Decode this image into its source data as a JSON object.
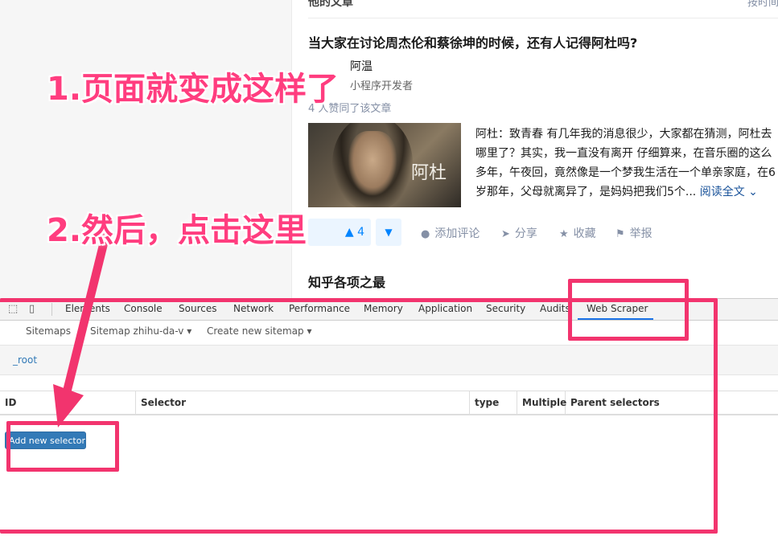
{
  "article": {
    "section_header": "他的文章",
    "section_link": "按时间",
    "title": "当大家在讨论周杰伦和蔡徐坤的时候，还有人记得阿杜吗?",
    "author_name": "阿温",
    "author_desc": "小程序开发者",
    "likers": "4 人赞同了该文章",
    "thumb_text": "阿杜",
    "excerpt": "阿杜：致青春 有几年我的消息很少，大家都在猜测，阿杜去哪里了？其实，我一直没有离开 仔细算来，在音乐圈的这么多年，午夜回，竟然像是一个梦我生活在一个单亲家庭，在6岁那年，父母就离异了，是妈妈把我们5个...",
    "read_more": "阅读全文 ⌄",
    "vote_up": "▲ 4",
    "vote_down": "▼",
    "actions": {
      "comment": "添加评论",
      "share": "分享",
      "favorite": "收藏",
      "report": "举报"
    },
    "next_title": "知乎各项之最"
  },
  "devtools": {
    "tabs": [
      "Elements",
      "Console",
      "Sources",
      "Network",
      "Performance",
      "Memory",
      "Application",
      "Security",
      "Audits",
      "Web Scraper"
    ],
    "active_tab": "Web Scraper",
    "subnav": {
      "sitemaps": "Sitemaps",
      "sitemap": "Sitemap zhihu-da-v ▾",
      "create": "Create new sitemap ▾"
    },
    "breadcrumb": "_root",
    "columns": [
      "ID",
      "Selector",
      "type",
      "Multiple",
      "Parent selectors"
    ],
    "add_button": "Add new selector"
  },
  "annotations": {
    "step1": "1.页面就变成这样了",
    "step2": "2.然后，点击这里",
    "color": "#f2346e"
  },
  "icons": [
    "cursor-select-icon",
    "device-toggle-icon",
    "comment-icon",
    "share-icon",
    "star-icon",
    "flag-icon"
  ]
}
